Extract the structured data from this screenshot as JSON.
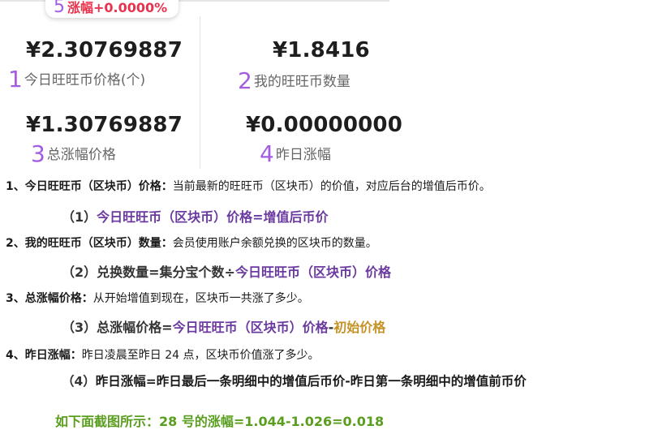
{
  "badge": {
    "number": "5",
    "text": "涨幅+0.0000%"
  },
  "stats": [
    {
      "value": "¥2.30769887",
      "number": "1",
      "label": "今日旺旺币价格(个)"
    },
    {
      "value": "¥1.8416",
      "number": "2",
      "label": "我的旺旺币数量"
    },
    {
      "value": "¥1.30769887",
      "number": "3",
      "label": "总涨幅价格"
    },
    {
      "value": "¥0.00000000",
      "number": "4",
      "label": "昨日涨幅"
    }
  ],
  "definitions": [
    {
      "prefix": "1、",
      "term": "今日旺旺币（区块币）价格：",
      "desc": "当前最新的旺旺币（区块币）的价值，对应后台的增值后币价。",
      "formula": {
        "no": "（1）",
        "a": "今日旺旺币（区块币）价格=增值后币价"
      }
    },
    {
      "prefix": "2、",
      "term": "我的旺旺币（区块币）数量：",
      "desc": "会员使用账户余额兑换的区块币的数量。",
      "formula": {
        "no": "（2）",
        "a": "兑换数量=集分宝个数÷",
        "b": "今日旺旺币（区块币）价格"
      }
    },
    {
      "prefix": "3、",
      "term": "总涨幅价格：",
      "desc": "从开始增值到现在，区块币一共涨了多少。",
      "formula": {
        "no": "（3）",
        "a": "总涨幅价格=",
        "b": "今日旺旺币（区块币）价格",
        "c": "-",
        "d": "初始价格"
      }
    },
    {
      "prefix": "4、",
      "term": "昨日涨幅：",
      "desc": "昨日凌晨至昨日 24 点，区块币价值涨了多少。",
      "formula": {
        "no": "（4）",
        "a": "昨日涨幅=昨日最后一条明细中的增值后币价-昨日第一条明细中的增值前币价"
      }
    }
  ],
  "example": "如下面截图所示：28 号的涨幅=1.044-1.026=0.018"
}
